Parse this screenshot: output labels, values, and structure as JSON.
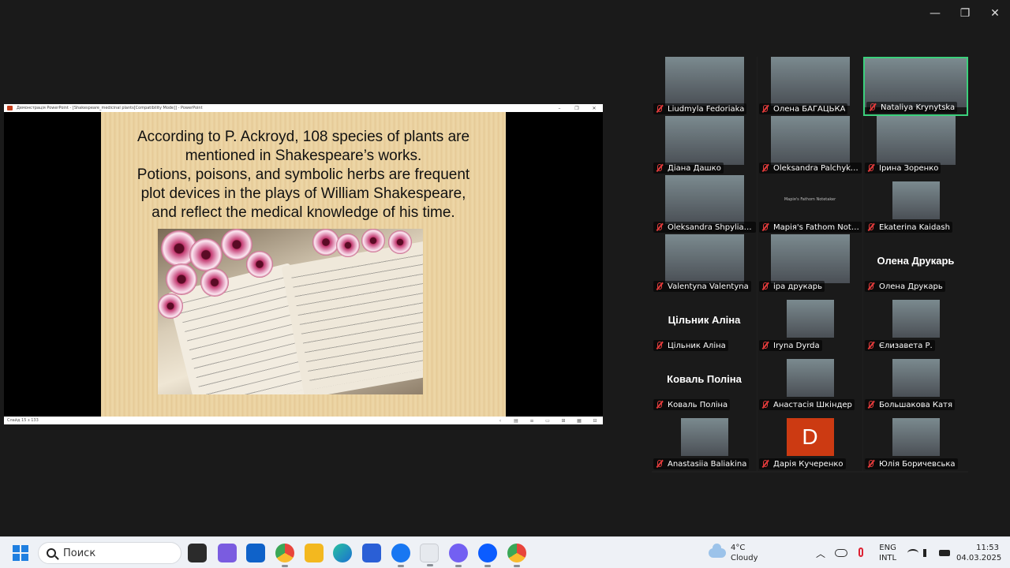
{
  "window_controls": {
    "minimize": "—",
    "restore": "❐",
    "close": "✕"
  },
  "ppt": {
    "title": "Демонстрація PowerPoint - [Shakespeare_medicinal plants[Compatibility Mode]] - PowerPoint",
    "title_buttons": [
      "–",
      "❐",
      "✕"
    ],
    "slide_lines": [
      "According to P. Ackroyd, 108 species of plants are",
      "mentioned in Shakespeare’s works.",
      "Potions, poisons, and symbolic herbs are frequent",
      "plot devices in the plays of William Shakespeare,",
      "and reflect the medical knowledge of his time."
    ],
    "status": "Слайд 15 з 133",
    "status_buttons": [
      "‹",
      "▤",
      "≡",
      "▭",
      "⊞",
      "▦",
      "⊟"
    ]
  },
  "participants": [
    {
      "name": "Liudmyla Fedoriaka",
      "kind": "video"
    },
    {
      "name": "Олена БАГАЦЬКА",
      "kind": "video"
    },
    {
      "name": "Nataliya Krynytska",
      "kind": "video",
      "active": true
    },
    {
      "name": "Діана Дашко",
      "kind": "video"
    },
    {
      "name": "Oleksandra Palchykova",
      "kind": "video"
    },
    {
      "name": "Ірина Зоренко",
      "kind": "video"
    },
    {
      "name": "Oleksandra Shpyliakova",
      "kind": "video"
    },
    {
      "name": "Марія's Fathom Notetaker",
      "kind": "tiny",
      "display": "Марія's Fathom Notetaker"
    },
    {
      "name": "Ekaterina Kaidash",
      "kind": "avatar"
    },
    {
      "name": "Valentyna Valentyna",
      "kind": "video"
    },
    {
      "name": "іра друкарь",
      "kind": "video"
    },
    {
      "name": "Олена Друкарь",
      "kind": "text",
      "display": "Олена Друкарь"
    },
    {
      "name": "Цільник Аліна",
      "kind": "text",
      "display": "Цільник Аліна"
    },
    {
      "name": "Iryna Dyrda",
      "kind": "avatar"
    },
    {
      "name": "Єлизавета Р.",
      "kind": "avatar"
    },
    {
      "name": "Коваль Поліна",
      "kind": "text",
      "display": "Коваль Поліна"
    },
    {
      "name": "Анастасія Шкіндер",
      "kind": "avatar"
    },
    {
      "name": "Большакова Катя",
      "kind": "avatar"
    },
    {
      "name": "Anastasiia Baliakina",
      "kind": "avatar"
    },
    {
      "name": "Дарія Кучеренко",
      "kind": "letter",
      "display": "D"
    },
    {
      "name": "Юлія Боричевська",
      "kind": "avatar"
    }
  ],
  "taskbar": {
    "search_placeholder": "Поиск",
    "weather_temp": "4°C",
    "weather_desc": "Cloudy",
    "lang_top": "ENG",
    "lang_bottom": "INTL",
    "time": "11:53",
    "date": "04.03.2025",
    "tray_chevron": "︿"
  }
}
